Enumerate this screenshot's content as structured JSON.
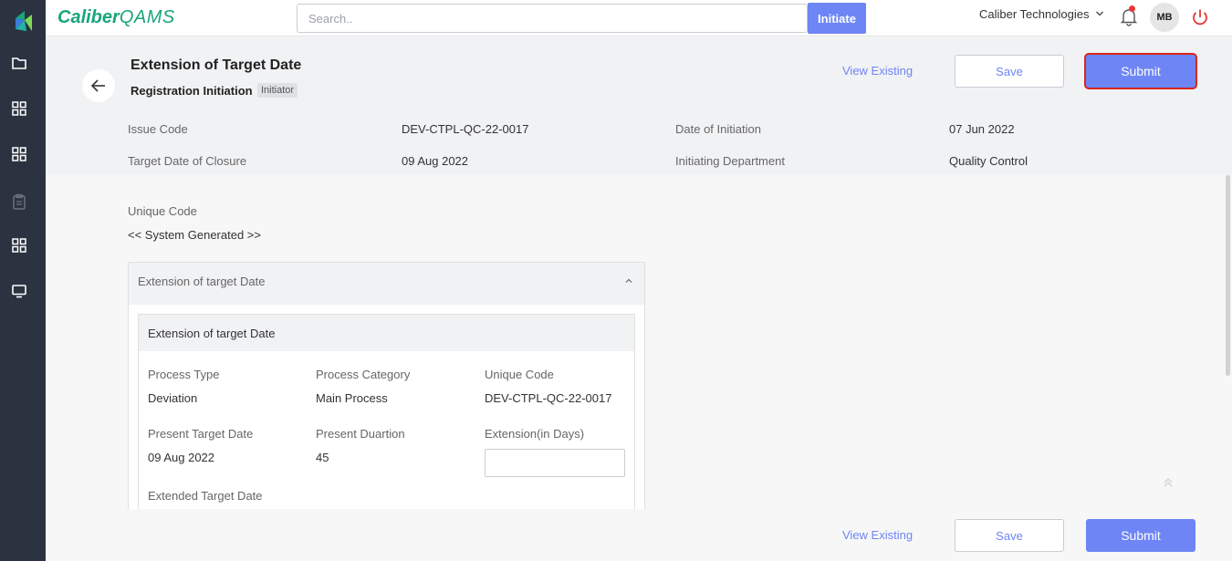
{
  "brand": {
    "part1": "Caliber",
    "part2": "QAMS"
  },
  "topbar": {
    "search_placeholder": "Search..",
    "initiate_label": "Initiate",
    "company": "Caliber Technologies",
    "avatar_initials": "MB"
  },
  "header": {
    "title": "Extension of Target Date",
    "subtitle": "Registration Initiation",
    "role_badge": "Initiator",
    "view_existing": "View Existing",
    "save_label": "Save",
    "submit_label": "Submit"
  },
  "meta": {
    "issue_code_label": "Issue Code",
    "issue_code_value": "DEV-CTPL-QC-22-0017",
    "date_of_initiation_label": "Date of Initiation",
    "date_of_initiation_value": "07 Jun 2022",
    "target_date_label": "Target Date of Closure",
    "target_date_value": "09 Aug 2022",
    "initiating_dept_label": "Initiating Department",
    "initiating_dept_value": "Quality Control"
  },
  "content": {
    "unique_code_label": "Unique Code",
    "unique_code_value": "<< System Generated >>",
    "accordion_title": "Extension of target Date",
    "card_title": "Extension of target Date",
    "fields": {
      "process_type_label": "Process Type",
      "process_type_value": "Deviation",
      "process_category_label": "Process Category",
      "process_category_value": "Main Process",
      "unique_code_label": "Unique Code",
      "unique_code_value": "DEV-CTPL-QC-22-0017",
      "present_target_label": "Present Target Date",
      "present_target_value": "09 Aug 2022",
      "present_duration_label": "Present Duartion",
      "present_duration_value": "45",
      "extension_label": "Extension(in Days)",
      "extension_value": "",
      "extended_target_label": "Extended Target Date"
    }
  },
  "footer": {
    "view_existing": "View Existing",
    "save_label": "Save",
    "submit_label": "Submit"
  },
  "colors": {
    "sidebar_bg": "#2b3340",
    "accent": "#6e85f5",
    "brand_green": "#1aa57a",
    "alert_red": "#e53935"
  },
  "icons": {
    "sidebar": [
      "caliber-logo-icon",
      "folder-icon",
      "grid-icon",
      "grid-icon",
      "clipboard-icon",
      "grid-icon",
      "monitor-icon"
    ],
    "topbar": [
      "chevron-down-icon",
      "bell-icon",
      "power-icon"
    ]
  }
}
